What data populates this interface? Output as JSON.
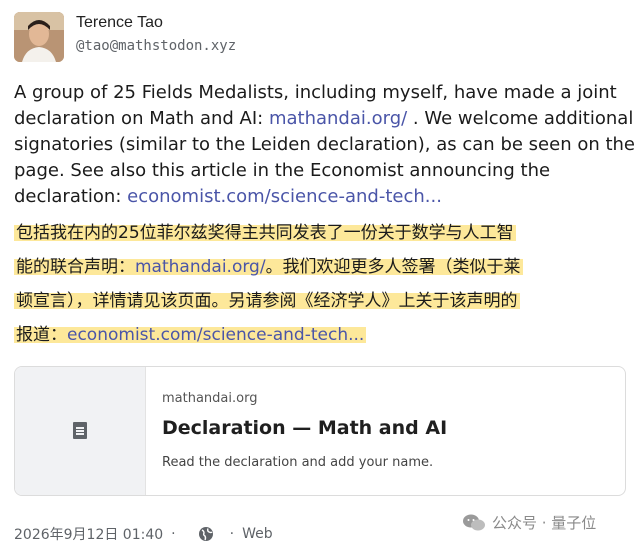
{
  "author": {
    "display_name": "Terence Tao",
    "handle": "@tao@mathstodon.xyz"
  },
  "post_en": {
    "line1": "A group of 25 Fields Medalists, including myself, have made a joint",
    "line2_pre": "declaration on Math and AI: ",
    "link1": "mathandai.org/",
    "line2_post": " .  We welcome additional",
    "line3": "signatories (similar to the Leiden declaration), as can be seen on the",
    "line4": "page.  See also this article in the Economist announcing the",
    "line5_pre": "declaration: ",
    "link2": "economist.com/science-and-tech..."
  },
  "post_zh": {
    "line1": "包括我在内的25位菲尔兹奖得主共同发表了一份关于数学与人工智",
    "line2_pre": "能的联合声明：",
    "link1": "mathandai.org/",
    "line2_post": "。我们欢迎更多人签署（类似于莱",
    "line3": "顿宣言），详情请见该页面。另请参阅《经济学人》上关于该声明的",
    "line4_pre": "报道：",
    "link2": "economist.com/science-and-tech..."
  },
  "link_card": {
    "domain": "mathandai.org",
    "title": "Declaration — Math and AI",
    "description": "Read the declaration and add your name.",
    "icon": "document-icon"
  },
  "footer": {
    "timestamp": "2026年9月12日 01:40",
    "separator": "·",
    "visibility_icon": "globe-icon",
    "client": "Web"
  },
  "watermark": {
    "icon": "wechat-icon",
    "text": "公众号 · 量子位"
  },
  "colors": {
    "link": "#4a55a8",
    "highlight": "#fde89a",
    "muted": "#5f6368"
  }
}
